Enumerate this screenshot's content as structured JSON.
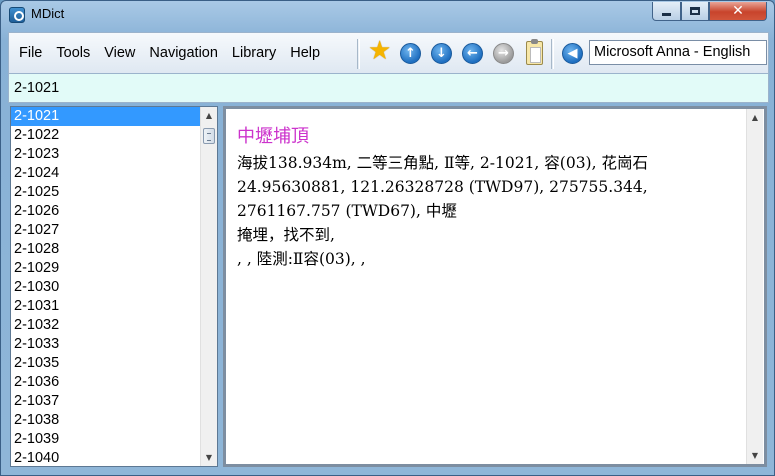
{
  "window": {
    "title": "MDict"
  },
  "menu": {
    "items": [
      "File",
      "Tools",
      "View",
      "Navigation",
      "Library",
      "Help"
    ]
  },
  "toolbar": {
    "icons": [
      "star-icon",
      "arrow-up-icon",
      "arrow-down-icon",
      "arrow-left-icon",
      "arrow-right-icon",
      "clipboard-icon",
      "speaker-icon"
    ],
    "voice_value": "Microsoft Anna - English"
  },
  "search": {
    "value": "2-1021"
  },
  "word_list": {
    "items": [
      "2-1021",
      "2-1022",
      "2-1023",
      "2-1024",
      "2-1025",
      "2-1026",
      "2-1027",
      "2-1028",
      "2-1029",
      "2-1030",
      "2-1031",
      "2-1032",
      "2-1033",
      "2-1035",
      "2-1036",
      "2-1037",
      "2-1038",
      "2-1039",
      "2-1040"
    ],
    "selected": "2-1021"
  },
  "entry": {
    "title": "中壢埔頂",
    "lines": [
      "海拔138.934m, 二等三角點, Ⅱ等, 2-1021, 容(03), 花崗石",
      "24.95630881, 121.26328728 (TWD97), 275755.344, 2761167.757 (TWD67), 中壢",
      "掩埋，找不到,",
      ", , 陸測:Ⅱ容(03), ,"
    ]
  },
  "colors": {
    "selection": "#3399ff",
    "entry_title": "#cc33cc",
    "search_background": "#e2fbf8"
  }
}
